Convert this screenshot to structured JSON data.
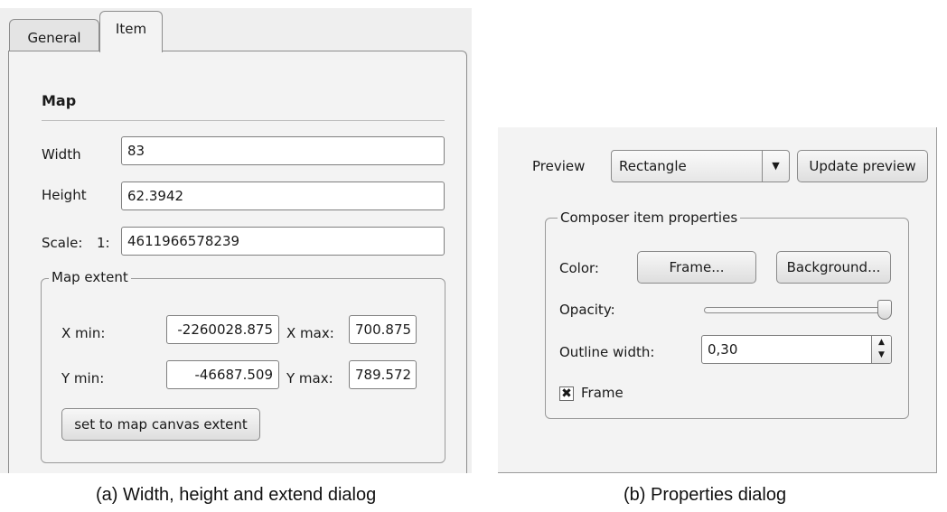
{
  "panel_a": {
    "tabs": [
      {
        "label": "General"
      },
      {
        "label": "Item"
      }
    ],
    "section_title": "Map",
    "width": {
      "label": "Width",
      "value": "83"
    },
    "height": {
      "label": "Height",
      "value": "62.3942"
    },
    "scale": {
      "label": "Scale:",
      "prefix": "1:",
      "value": "4611966578239"
    },
    "extent": {
      "title": "Map extent",
      "x_min_label": "X min:",
      "x_min_value": "-2260028.875",
      "x_max_label": "X max:",
      "x_max_value": "700.875",
      "y_min_label": "Y min:",
      "y_min_value": "-46687.509",
      "y_max_label": "Y max:",
      "y_max_value": "789.572",
      "button": "set to map canvas extent"
    }
  },
  "panel_b": {
    "preview_label": "Preview",
    "preview_combo": "Rectangle",
    "update_button": "Update preview",
    "group_title": "Composer item properties",
    "color_label": "Color:",
    "frame_button": "Frame...",
    "background_button": "Background...",
    "opacity_label": "Opacity:",
    "opacity_level": 1.0,
    "outline_label": "Outline width:",
    "outline_value": "0,30",
    "frame_checkbox_label": "Frame",
    "frame_checked": true
  },
  "captions": {
    "a": "(a)  Width, height and extend dialog",
    "b": "(b)  Properties dialog"
  }
}
